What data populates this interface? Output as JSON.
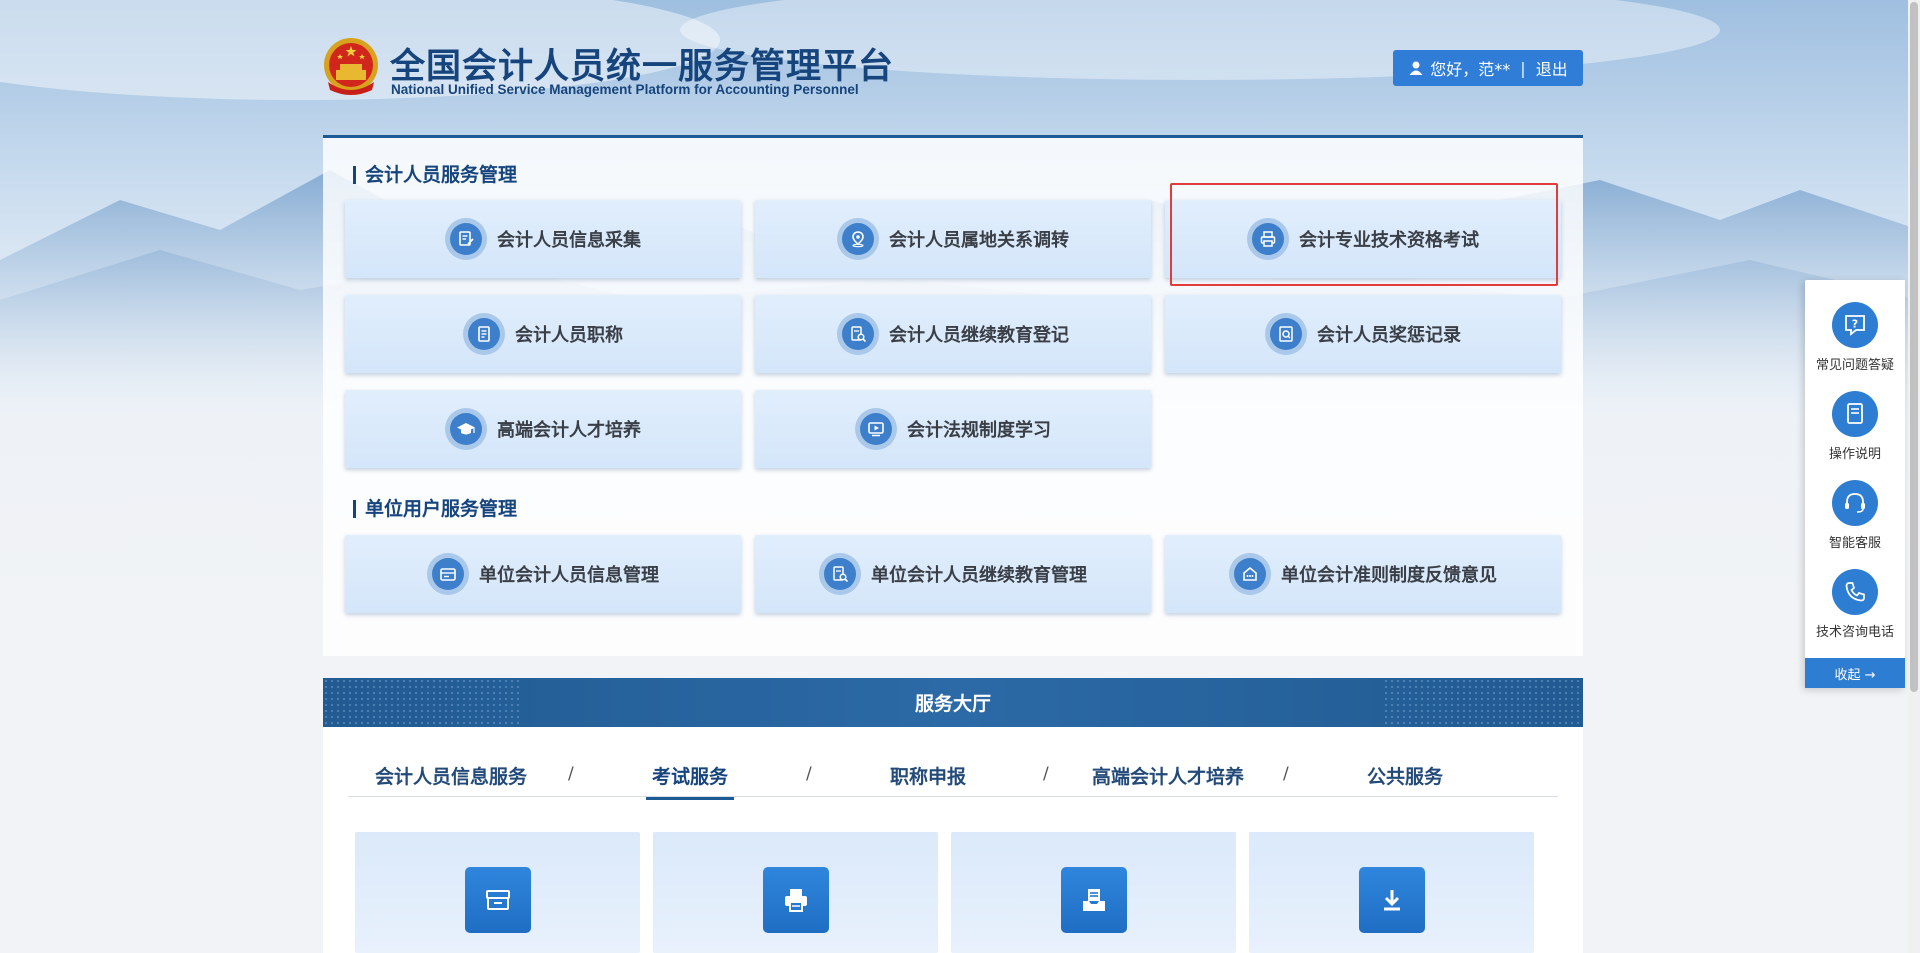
{
  "header": {
    "title_cn": "全国会计人员统一服务管理平台",
    "title_en": "National Unified Service Management Platform for Accounting Personnel",
    "greeting": "您好，范**",
    "separator": "|",
    "logout": "退出"
  },
  "section1": {
    "title": "会计人员服务管理",
    "tiles": [
      {
        "label": "会计人员信息采集",
        "icon": "edit-doc-icon"
      },
      {
        "label": "会计人员属地关系调转",
        "icon": "location-icon"
      },
      {
        "label": "会计专业技术资格考试",
        "icon": "printer-icon"
      },
      {
        "label": "会计人员职称",
        "icon": "document-icon"
      },
      {
        "label": "会计人员继续教育登记",
        "icon": "search-doc-icon"
      },
      {
        "label": "会计人员奖惩记录",
        "icon": "record-icon"
      },
      {
        "label": "高端会计人才培养",
        "icon": "graduation-cap-icon"
      },
      {
        "label": "会计法规制度学习",
        "icon": "video-play-icon"
      }
    ]
  },
  "section2": {
    "title": "单位用户服务管理",
    "tiles": [
      {
        "label": "单位会计人员信息管理",
        "icon": "id-card-icon"
      },
      {
        "label": "单位会计人员继续教育管理",
        "icon": "search-doc-icon"
      },
      {
        "label": "单位会计准则制度反馈意见",
        "icon": "feedback-icon"
      }
    ]
  },
  "hall": {
    "title": "服务大厅",
    "tabs": [
      "会计人员信息服务",
      "考试服务",
      "职称申报",
      "高端会计人才培养",
      "公共服务"
    ],
    "active_tab": "考试服务",
    "tab_separator": "/",
    "cards": [
      {
        "icon": "archive-box-icon"
      },
      {
        "icon": "printer-icon"
      },
      {
        "icon": "inbox-doc-icon"
      },
      {
        "icon": "download-icon"
      }
    ]
  },
  "side_panel": {
    "items": [
      {
        "label": "常见问题答疑",
        "icon": "question-icon"
      },
      {
        "label": "操作说明",
        "icon": "manual-icon"
      },
      {
        "label": "智能客服",
        "icon": "headset-icon"
      },
      {
        "label": "技术咨询电话",
        "icon": "phone-icon"
      }
    ],
    "collapse_label": "收起 →"
  },
  "colors": {
    "primary": "#16447c",
    "accent": "#2d7dd2",
    "tile_bg": "#d4e6fa",
    "highlight": "#e23b3b"
  }
}
